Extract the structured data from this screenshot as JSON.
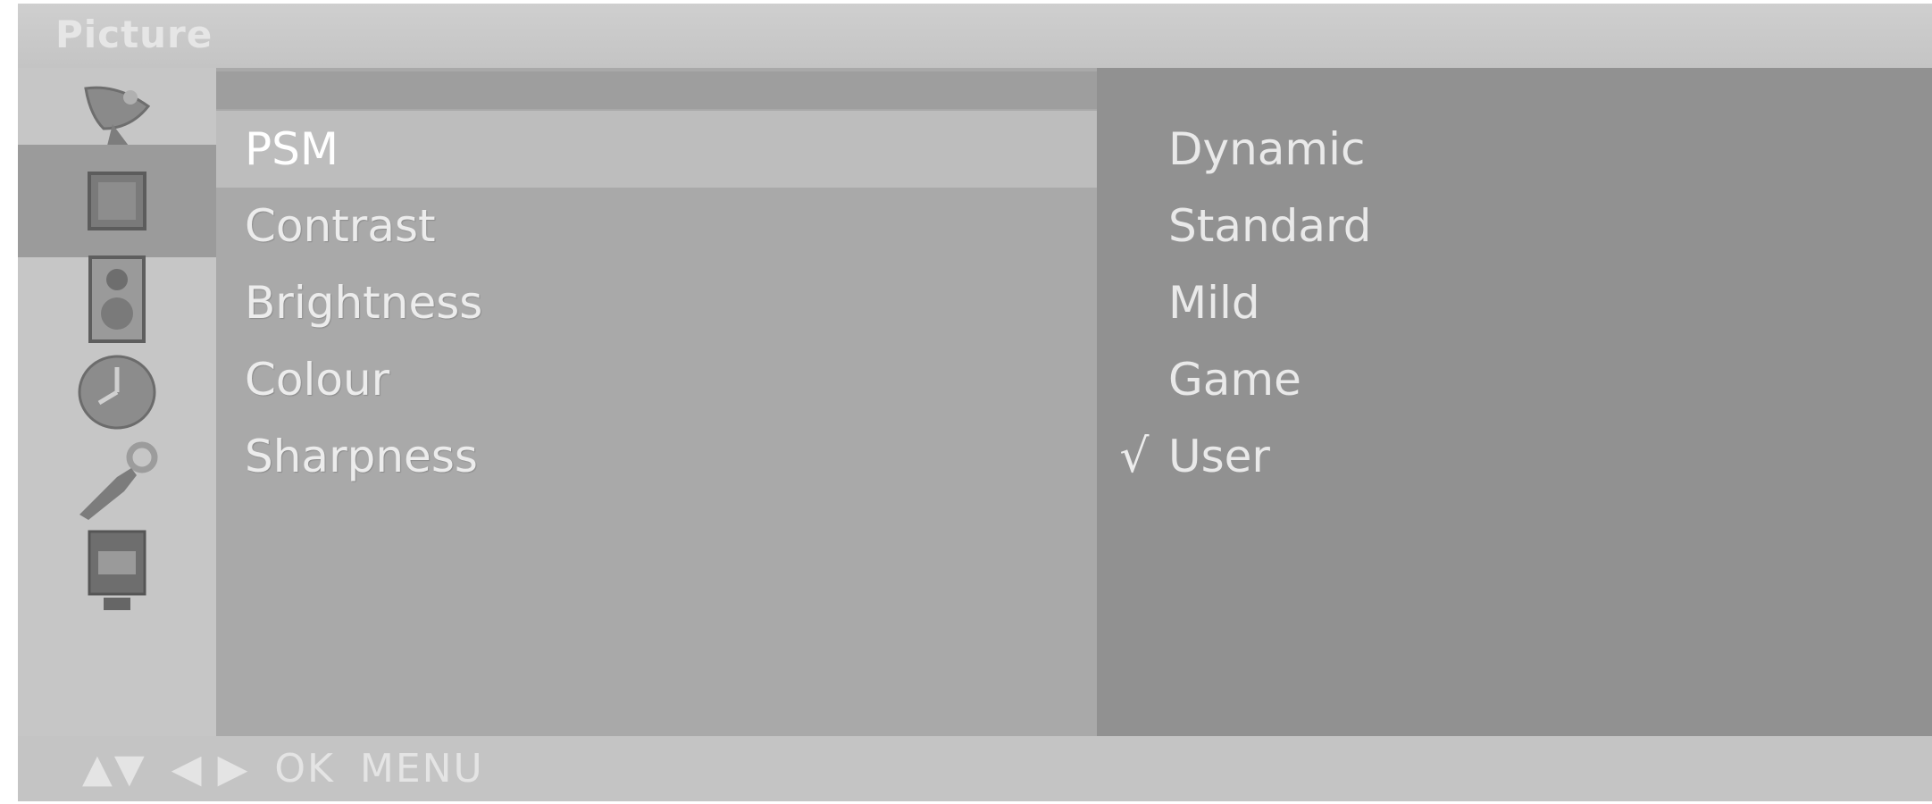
{
  "window": {
    "title": "Picture"
  },
  "sidebar": {
    "icons": [
      {
        "name": "satellite-dish-icon",
        "active": false
      },
      {
        "name": "picture-square-icon",
        "active": true
      },
      {
        "name": "speaker-icon",
        "active": false
      },
      {
        "name": "clock-icon",
        "active": false
      },
      {
        "name": "wrench-icon",
        "active": false
      },
      {
        "name": "screen-icon",
        "active": false
      }
    ]
  },
  "menu": {
    "items": [
      {
        "label": "PSM",
        "selected": true
      },
      {
        "label": "Contrast",
        "selected": false
      },
      {
        "label": "Brightness",
        "selected": false
      },
      {
        "label": "Colour",
        "selected": false
      },
      {
        "label": "Sharpness",
        "selected": false
      }
    ]
  },
  "options": {
    "items": [
      {
        "label": "Dynamic",
        "checked": false
      },
      {
        "label": "Standard",
        "checked": false
      },
      {
        "label": "Mild",
        "checked": false
      },
      {
        "label": "Game",
        "checked": false
      },
      {
        "label": "User",
        "checked": true
      }
    ],
    "check_mark": "√"
  },
  "navbar": {
    "updown": "▲▼",
    "leftright": "◀ ▶",
    "ok": "OK",
    "menu": "MENU"
  },
  "colors": {
    "title_bar": "#c8c8c8",
    "icon_active": "#9b9b9b",
    "menu_bg": "#a9a9a9",
    "menu_selected": "#bdbdbd",
    "options_bg": "#919191"
  }
}
